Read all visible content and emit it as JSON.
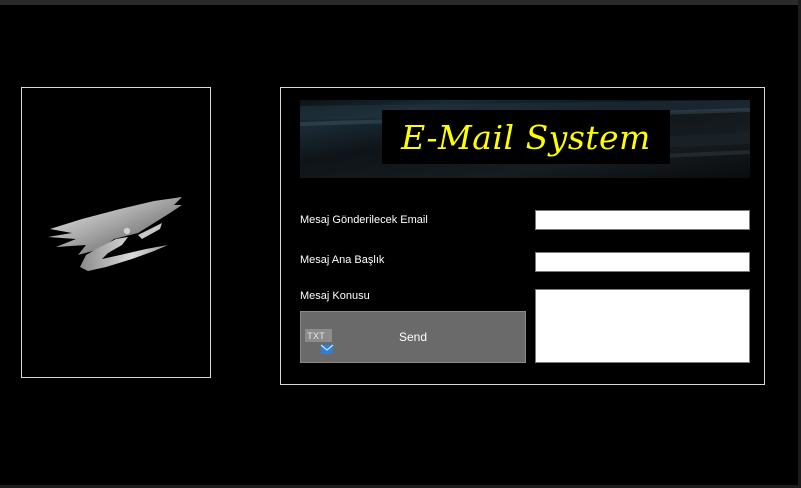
{
  "banner": {
    "title": "E-Mail System"
  },
  "form": {
    "email_label": "Mesaj Gönderilecek Email",
    "email_value": "",
    "subject_label": "Mesaj Ana Başlık",
    "subject_value": "",
    "body_label": "Mesaj Konusu",
    "body_value": "",
    "send_label": "Send",
    "send_icon_text": "TXT"
  },
  "icons": {
    "logo": "eagle-logo-icon",
    "send": "txt-mail-icon"
  },
  "colors": {
    "background": "#000000",
    "title_text": "#ffff00",
    "button": "#6a6a6a",
    "panel_border": "#d8d8d8",
    "mail_icon": "#2f7fd6"
  }
}
